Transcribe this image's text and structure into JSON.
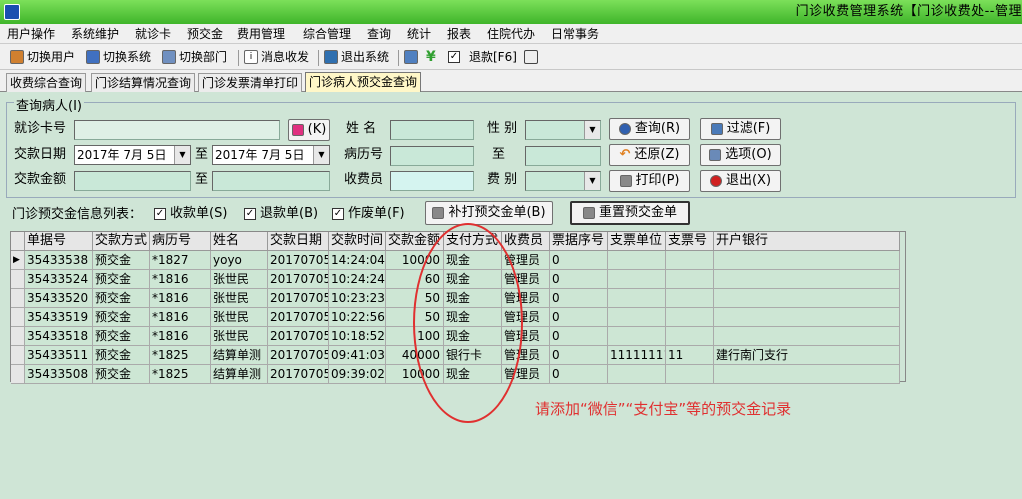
{
  "window": {
    "title": "门诊收费管理系统【门诊收费处--管理"
  },
  "menu": [
    "用户操作",
    "系统维护",
    "就诊卡",
    "预交金",
    "费用管理",
    "综合管理",
    "查询",
    "统计",
    "报表",
    "住院代办",
    "日常事务"
  ],
  "toolbar": {
    "switch_user": "切换用户",
    "switch_system": "切换系统",
    "switch_dept": "切换部门",
    "message": "消息收发",
    "exit_system": "退出系统",
    "refund": "退款[F6]"
  },
  "tabs": [
    "收费综合查询",
    "门诊结算情况查询",
    "门诊发票清单打印",
    "门诊病人预交金查询"
  ],
  "query": {
    "group_title": "查询病人(I)",
    "card_no_label": "就诊卡号",
    "card_btn_label": "(K)",
    "name_label": "姓  名",
    "gender_label": "性  别",
    "date_label": "交款日期",
    "date_from": "2017年 7月 5日",
    "to_label_1": "至",
    "date_to": "2017年 7月 5日",
    "record_label": "病历号",
    "to_label_2": "至",
    "amount_label": "交款金额",
    "to_label_3": "至",
    "cashier_label": "收费员",
    "fee_type_label": "费  别",
    "buttons": {
      "query": "查询(R)",
      "filter": "过滤(F)",
      "restore": "还原(Z)",
      "options": "选项(O)",
      "print": "打印(P)",
      "exit": "退出(X)"
    }
  },
  "list": {
    "label": "门诊预交金信息列表：",
    "checks": [
      {
        "label": "收款单(S)",
        "checked": true
      },
      {
        "label": "退款单(B)",
        "checked": true
      },
      {
        "label": "作废单(F)",
        "checked": true
      }
    ],
    "reprint_btn": "补打预交金单(B)",
    "reset_btn": "重置预交金单"
  },
  "grid": {
    "columns": [
      "单据号",
      "交款方式",
      "病历号",
      "姓名",
      "交款日期",
      "交款时间",
      "交款金额",
      "支付方式",
      "收费员",
      "票据序号",
      "支票单位",
      "支票号",
      "开户银行"
    ],
    "rows": [
      [
        "35433538",
        "预交金",
        "*1827",
        "yoyo",
        "20170705",
        "14:24:04",
        "10000",
        "现金",
        "管理员",
        "0",
        "",
        "",
        ""
      ],
      [
        "35433524",
        "预交金",
        "*1816",
        "张世民",
        "20170705",
        "10:24:24",
        "60",
        "现金",
        "管理员",
        "0",
        "",
        "",
        ""
      ],
      [
        "35433520",
        "预交金",
        "*1816",
        "张世民",
        "20170705",
        "10:23:23",
        "50",
        "现金",
        "管理员",
        "0",
        "",
        "",
        ""
      ],
      [
        "35433519",
        "预交金",
        "*1816",
        "张世民",
        "20170705",
        "10:22:56",
        "50",
        "现金",
        "管理员",
        "0",
        "",
        "",
        ""
      ],
      [
        "35433518",
        "预交金",
        "*1816",
        "张世民",
        "20170705",
        "10:18:52",
        "100",
        "现金",
        "管理员",
        "0",
        "",
        "",
        ""
      ],
      [
        "35433511",
        "预交金",
        "*1825",
        "结算单测",
        "20170705",
        "09:41:03",
        "40000",
        "银行卡",
        "管理员",
        "0",
        "11111111",
        "11",
        "建行南门支行"
      ],
      [
        "35433508",
        "预交金",
        "*1825",
        "结算单测",
        "20170705",
        "09:39:02",
        "10000",
        "现金",
        "管理员",
        "0",
        "",
        "",
        ""
      ]
    ]
  },
  "annotation": "请添加“微信”“支付宝”等的预交金记录",
  "colors": {
    "title_green": "#3fb52a",
    "panel": "#cfe5d6",
    "annotation_red": "#e03030"
  }
}
